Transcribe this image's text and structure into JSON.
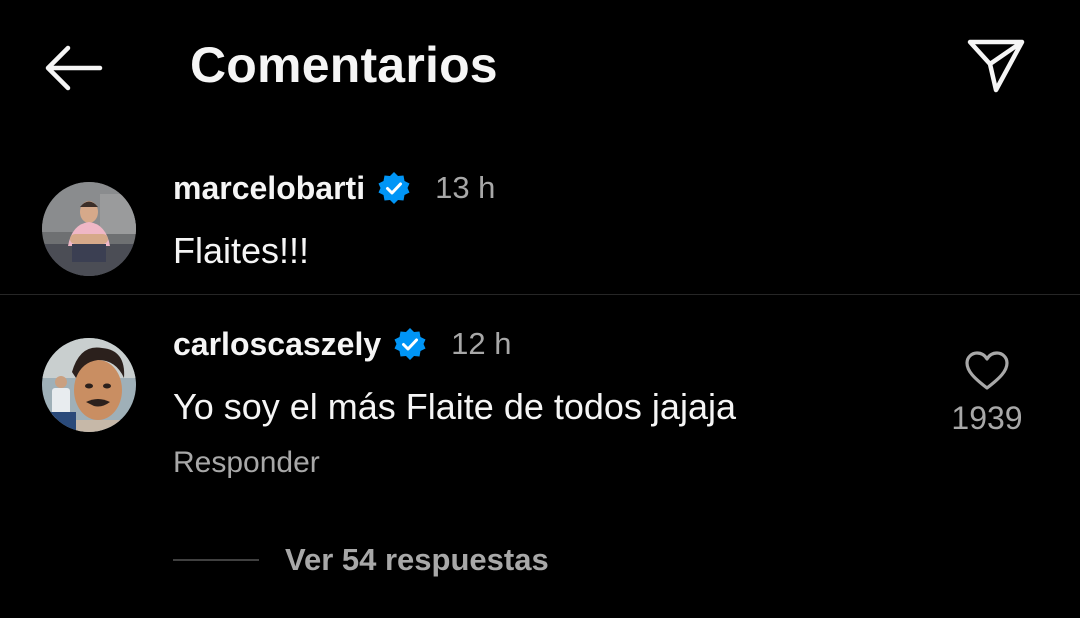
{
  "header": {
    "title": "Comentarios",
    "back_icon": "arrow-left-icon",
    "share_icon": "paper-plane-icon"
  },
  "comments": [
    {
      "username": "marcelobarti",
      "verified": true,
      "time": "13 h",
      "text": "Flaites!!!"
    },
    {
      "username": "carloscaszely",
      "verified": true,
      "time": "12 h",
      "text": "Yo soy el más Flaite de todos jajaja",
      "reply_label": "Responder",
      "likes": "1939",
      "view_replies": "Ver 54 respuestas"
    }
  ],
  "colors": {
    "background": "#000000",
    "primary_text": "#f5f5f5",
    "secondary_text": "#a8a8a8",
    "verified_blue": "#0095f6",
    "divider": "#262626"
  }
}
